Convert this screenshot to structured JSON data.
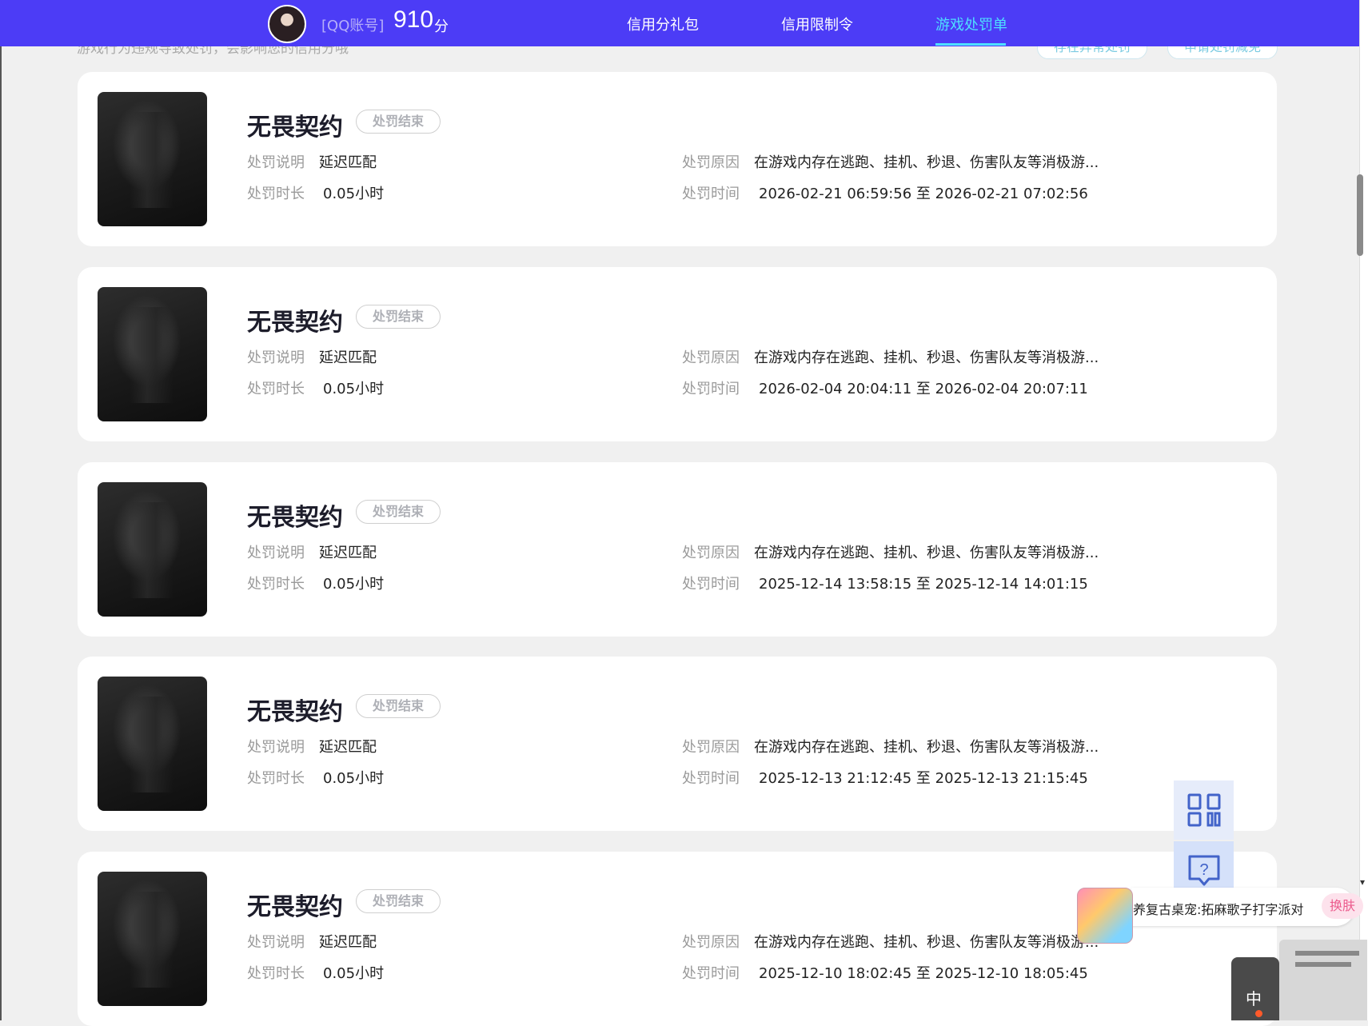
{
  "header": {
    "account_label": "[QQ账号]",
    "score": "910",
    "score_unit": "分",
    "nav": [
      "信用分礼包",
      "信用限制令",
      "游戏处罚单"
    ],
    "active_nav": "游戏处罚单"
  },
  "subheader": {
    "text": "游戏行为违规导致处罚，会影响您的信用分哦",
    "buttons": [
      "存在异常处罚",
      "申请处罚减免"
    ]
  },
  "labels": {
    "desc": "处罚说明",
    "duration": "处罚时长",
    "reason": "处罚原因",
    "time": "处罚时间"
  },
  "records": [
    {
      "game": "无畏契约",
      "status": "处罚结束",
      "desc": "延迟匹配",
      "duration": "0.05小时",
      "reason": "在游戏内存在逃跑、挂机、秒退、伤害队友等消极游...",
      "time": "2026-02-21 06:59:56 至 2026-02-21 07:02:56"
    },
    {
      "game": "无畏契约",
      "status": "处罚结束",
      "desc": "延迟匹配",
      "duration": "0.05小时",
      "reason": "在游戏内存在逃跑、挂机、秒退、伤害队友等消极游...",
      "time": "2026-02-04 20:04:11 至 2026-02-04 20:07:11"
    },
    {
      "game": "无畏契约",
      "status": "处罚结束",
      "desc": "延迟匹配",
      "duration": "0.05小时",
      "reason": "在游戏内存在逃跑、挂机、秒退、伤害队友等消极游...",
      "time": "2025-12-14 13:58:15 至 2025-12-14 14:01:15"
    },
    {
      "game": "无畏契约",
      "status": "处罚结束",
      "desc": "延迟匹配",
      "duration": "0.05小时",
      "reason": "在游戏内存在逃跑、挂机、秒退、伤害队友等消极游...",
      "time": "2025-12-13 21:12:45 至 2025-12-13 21:15:45"
    },
    {
      "game": "无畏契约",
      "status": "处罚结束",
      "desc": "延迟匹配",
      "duration": "0.05小时",
      "reason": "在游戏内存在逃跑、挂机、秒退、伤害队友等消极游...",
      "time": "2025-12-10 18:02:45 至 2025-12-10 18:05:45"
    }
  ],
  "floating": {
    "qr_icon": "qr-code-icon",
    "help_icon": "help-bubble-icon"
  },
  "pet_widget": {
    "text": "养复古桌宠:拓麻歌子打字派对",
    "skin_button": "换肤"
  },
  "ime": {
    "char": "中"
  }
}
